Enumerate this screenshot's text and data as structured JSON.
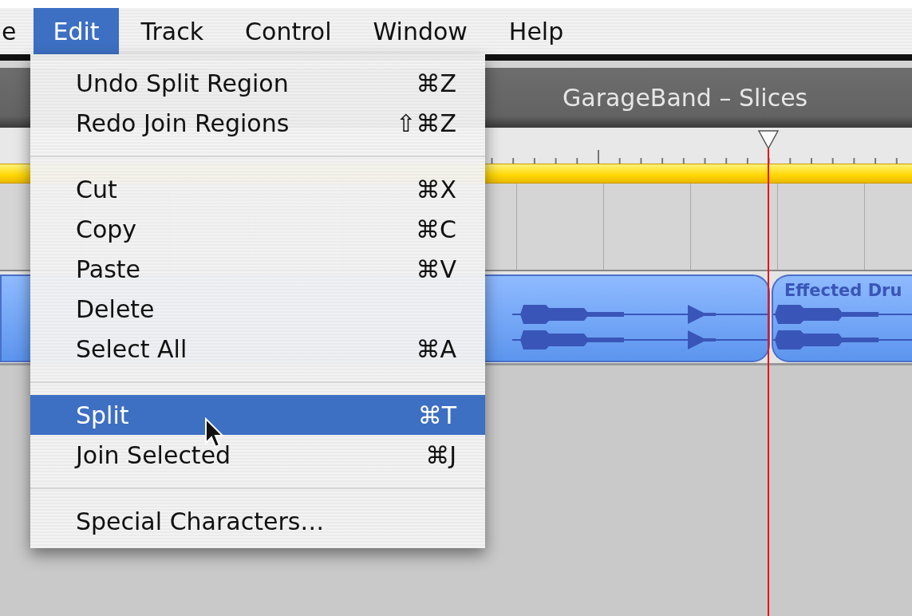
{
  "menu_bar": {
    "items": [
      {
        "label": "e",
        "selected": false
      },
      {
        "label": "Edit",
        "selected": true
      },
      {
        "label": "Track",
        "selected": false
      },
      {
        "label": "Control",
        "selected": false
      },
      {
        "label": "Window",
        "selected": false
      },
      {
        "label": "Help",
        "selected": false
      }
    ]
  },
  "window": {
    "title": "GarageBand – Slices"
  },
  "timeline": {
    "regions": [
      {
        "kind": "audio"
      },
      {
        "kind": "audio",
        "name": "Effected Dru"
      }
    ]
  },
  "edit_menu": {
    "items": [
      {
        "kind": "item",
        "label": "Undo Split Region",
        "shortcut": "⌘Z",
        "selected": false
      },
      {
        "kind": "item",
        "label": "Redo Join Regions",
        "shortcut": "⇧⌘Z",
        "selected": false
      },
      {
        "kind": "separator"
      },
      {
        "kind": "item",
        "label": "Cut",
        "shortcut": "⌘X",
        "selected": false
      },
      {
        "kind": "item",
        "label": "Copy",
        "shortcut": "⌘C",
        "selected": false
      },
      {
        "kind": "item",
        "label": "Paste",
        "shortcut": "⌘V",
        "selected": false
      },
      {
        "kind": "item",
        "label": "Delete",
        "selected": false
      },
      {
        "kind": "item",
        "label": "Select All",
        "shortcut": "⌘A",
        "selected": false
      },
      {
        "kind": "separator"
      },
      {
        "kind": "item",
        "label": "Split",
        "shortcut": "⌘T",
        "selected": true
      },
      {
        "kind": "item",
        "label": "Join Selected",
        "shortcut": "⌘J",
        "selected": false
      },
      {
        "kind": "separator"
      },
      {
        "kind": "item",
        "label": "Special Characters…",
        "selected": false
      }
    ]
  }
}
